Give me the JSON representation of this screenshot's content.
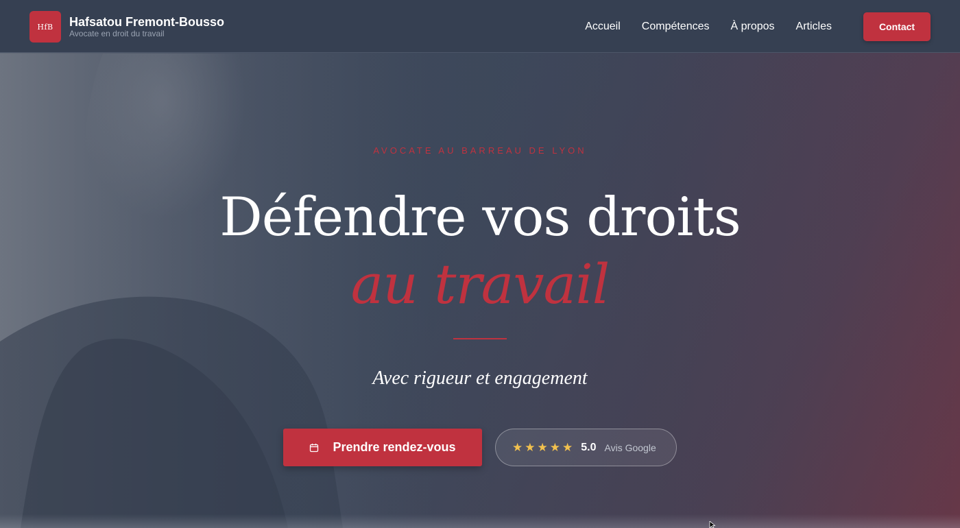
{
  "header": {
    "logo_text": "HfB",
    "brand_name": "Hafsatou Fremont-Bousso",
    "brand_tagline": "Avocate en droit du travail",
    "nav": [
      {
        "label": "Accueil"
      },
      {
        "label": "Compétences"
      },
      {
        "label": "À propos"
      },
      {
        "label": "Articles"
      }
    ],
    "contact_label": "Contact"
  },
  "hero": {
    "eyebrow": "AVOCATE AU BARREAU DE LYON",
    "title_line1": "Défendre vos droits",
    "title_line2": "au travail",
    "tagline": "Avec rigueur et engagement",
    "cta_label": "Prendre rendez-vous",
    "cta_icon": "calendar-icon",
    "rating": {
      "stars": 5,
      "value": "5.0",
      "label": "Avis Google"
    }
  },
  "colors": {
    "accent": "#c0323f",
    "header_bg": "#364052",
    "star": "#f2c14e"
  }
}
